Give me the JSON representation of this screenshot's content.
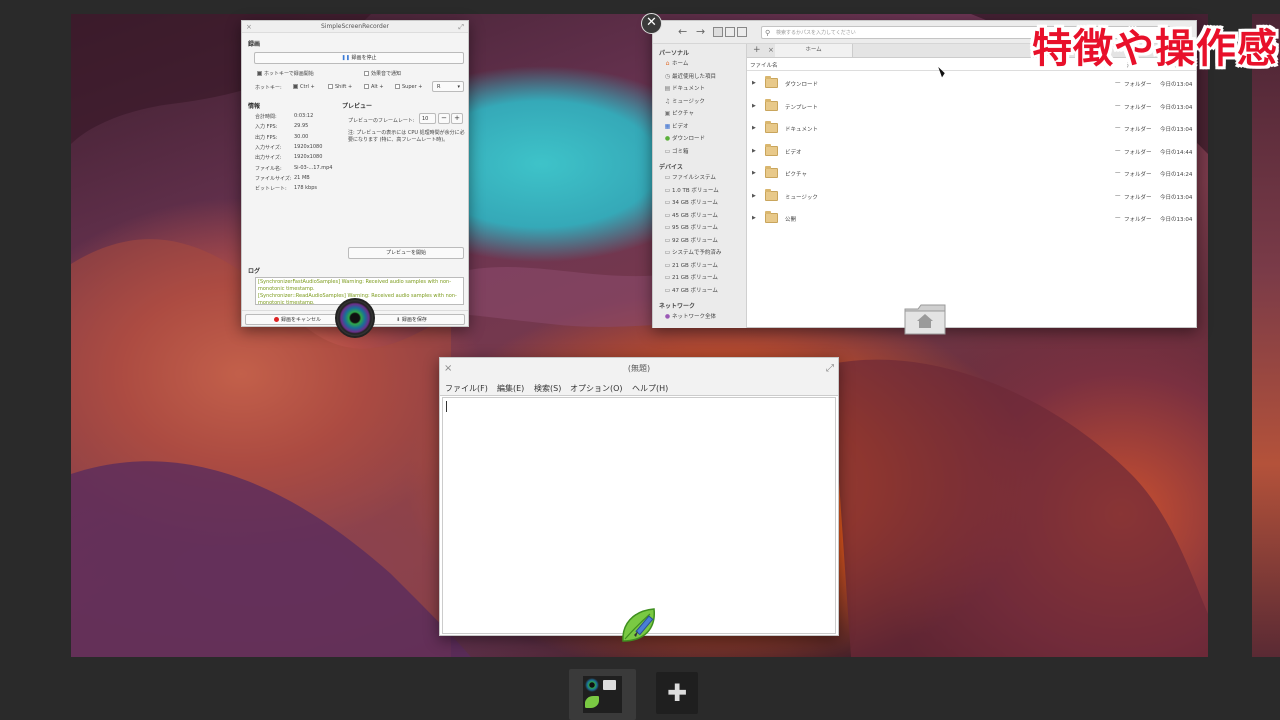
{
  "overlay_title": "特徴や操作感",
  "ssr": {
    "title": "SimpleScreenRecorder",
    "section_record": "録画",
    "pause_button": "録画を停止",
    "hotkey_check": "ホットキーで録画開始",
    "sound_check": "効果音で通知",
    "hotkey_label": "ホットキー:",
    "mod_ctrl": "Ctrl +",
    "mod_shift": "Shift +",
    "mod_alt": "Alt +",
    "mod_super": "Super +",
    "hotkey_key": "R",
    "section_info": "情報",
    "section_preview": "プレビュー",
    "info": [
      {
        "label": "合計時間:",
        "value": "0:03:12"
      },
      {
        "label": "入力 FPS:",
        "value": "29.95"
      },
      {
        "label": "出力 FPS:",
        "value": "30.00"
      },
      {
        "label": "入力サイズ:",
        "value": "1920x1080"
      },
      {
        "label": "出力サイズ:",
        "value": "1920x1080"
      },
      {
        "label": "ファイル名:",
        "value": "Si-03-...17.mp4"
      },
      {
        "label": "ファイルサイズ:",
        "value": "21 MB"
      },
      {
        "label": "ビットレート:",
        "value": "178 kbps"
      }
    ],
    "preview_fps_label": "プレビューのフレームレート:",
    "preview_fps_value": "10",
    "preview_note": "注: プレビューの表示には CPU 処理時間が余分に必要になります (特に、高フレームレート時)。",
    "preview_start": "プレビューを開始",
    "section_log": "ログ",
    "log_lines": [
      "[SynchronizerFastAudioSamples] Warning: Received audio samples with non-monotonic timestamp.",
      "[Synchronizer::ReadAudioSamples] Warning: Received audio samples with non-monotonic timestamp."
    ],
    "cancel_button": "録画をキャンセル",
    "save_button": "録画を保存"
  },
  "files": {
    "search_placeholder": "検索するかパスを入力してください",
    "sidebar": {
      "personal_head": "パーソナル",
      "personal": [
        {
          "icon": "home-icon",
          "glyph": "⌂",
          "label": "ホーム"
        },
        {
          "icon": "recent-icon",
          "glyph": "◷",
          "label": "最近使用した項目"
        },
        {
          "icon": "documents-icon",
          "glyph": "▤",
          "label": "ドキュメント"
        },
        {
          "icon": "music-icon",
          "glyph": "♫",
          "label": "ミュージック"
        },
        {
          "icon": "pictures-icon",
          "glyph": "▣",
          "label": "ピクチャ"
        },
        {
          "icon": "video-icon",
          "glyph": "▦",
          "label": "ビデオ"
        },
        {
          "icon": "download-icon",
          "glyph": "●",
          "label": "ダウンロード"
        },
        {
          "icon": "trash-icon",
          "glyph": "▭",
          "label": "ゴミ箱"
        }
      ],
      "devices_head": "デバイス",
      "devices": [
        "ファイルシステム",
        "1.0 TB ボリューム",
        "34 GB ボリューム",
        "45 GB ボリューム",
        "95 GB ボリューム",
        "92 GB ボリューム",
        "システムで予約済み",
        "21 GB ボリューム",
        "21 GB ボリューム",
        "47 GB ボリューム"
      ],
      "network_head": "ネットワーク",
      "network": [
        "ネットワーク全体"
      ]
    },
    "tab_label": "ホーム",
    "columns": {
      "name": "ファイル名",
      "size": "サイズ",
      "type": "形式",
      "modified": "変更日時"
    },
    "rows": [
      {
        "name": "ダウンロード",
        "size": "—",
        "type": "フォルダー",
        "modified": "今日の13:04"
      },
      {
        "name": "テンプレート",
        "size": "—",
        "type": "フォルダー",
        "modified": "今日の13:04"
      },
      {
        "name": "ドキュメント",
        "size": "—",
        "type": "フォルダー",
        "modified": "今日の13:04"
      },
      {
        "name": "ビデオ",
        "size": "—",
        "type": "フォルダー",
        "modified": "今日の14:44"
      },
      {
        "name": "ピクチャ",
        "size": "—",
        "type": "フォルダー",
        "modified": "今日の14:24"
      },
      {
        "name": "ミュージック",
        "size": "—",
        "type": "フォルダー",
        "modified": "今日の13:04"
      },
      {
        "name": "公開",
        "size": "—",
        "type": "フォルダー",
        "modified": "今日の13:04"
      }
    ]
  },
  "editor": {
    "title": "(無題)",
    "menu": [
      "ファイル(F)",
      "編集(E)",
      "検索(S)",
      "オプション(O)",
      "ヘルプ(H)"
    ]
  },
  "bottom": {
    "add_glyph": "✚"
  }
}
